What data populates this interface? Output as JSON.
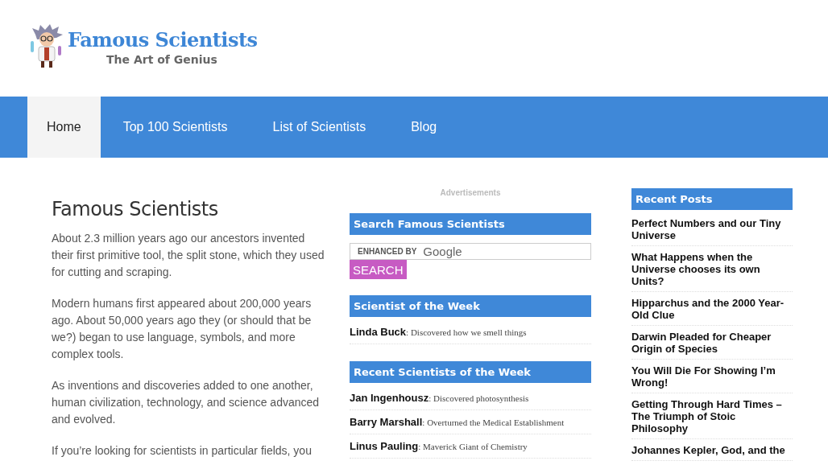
{
  "site": {
    "title": "Famous Scientists",
    "tagline": "The Art of Genius"
  },
  "nav": [
    {
      "label": "Home",
      "selected": true
    },
    {
      "label": "Top 100 Scientists",
      "selected": false
    },
    {
      "label": "List of Scientists",
      "selected": false
    },
    {
      "label": "Blog",
      "selected": false
    }
  ],
  "article": {
    "title": "Famous Scientists",
    "paragraphs": [
      "About 2.3 million years ago our ancestors invented their first primitive tool, the split stone, which they used for cutting and scraping.",
      "Modern humans first appeared about 200,000 years ago. About 50,000 years ago they (or should that be we?) began to use language, symbols, and more complex tools.",
      "As inventions and discoveries added to one another, human civilization, technology, and science advanced and evolved.",
      "If you’re looking for scientists in particular fields, you"
    ]
  },
  "middle": {
    "ads_label": "Advertisements",
    "search": {
      "heading": "Search Famous Scientists",
      "placeholder_prefix": "ENHANCED BY",
      "placeholder_brand": "Google",
      "button": "SEARCH"
    },
    "week": {
      "heading": "Scientist of the Week",
      "items": [
        {
          "name": "Linda Buck",
          "desc": ": Discovered how we smell things"
        }
      ]
    },
    "recent": {
      "heading": "Recent Scientists of the Week",
      "items": [
        {
          "name": "Jan Ingenhousz",
          "desc": ": Discovered photosynthesis"
        },
        {
          "name": "Barry Marshall",
          "desc": ": Overturned the Medical Establishment"
        },
        {
          "name": "Linus Pauling",
          "desc": ": Maverick Giant of Chemistry"
        }
      ]
    }
  },
  "recent_posts": {
    "heading": "Recent Posts",
    "items": [
      "Perfect Numbers and our Tiny Universe",
      "What Happens when the Universe chooses its own Units?",
      "Hipparchus and the 2000 Year-Old Clue",
      "Darwin Pleaded for Cheaper Origin of Species",
      "You Will Die For Showing I’m Wrong!",
      "Getting Through Hard Times – The Triumph of Stoic Philosophy",
      "Johannes Kepler, God, and the"
    ]
  }
}
